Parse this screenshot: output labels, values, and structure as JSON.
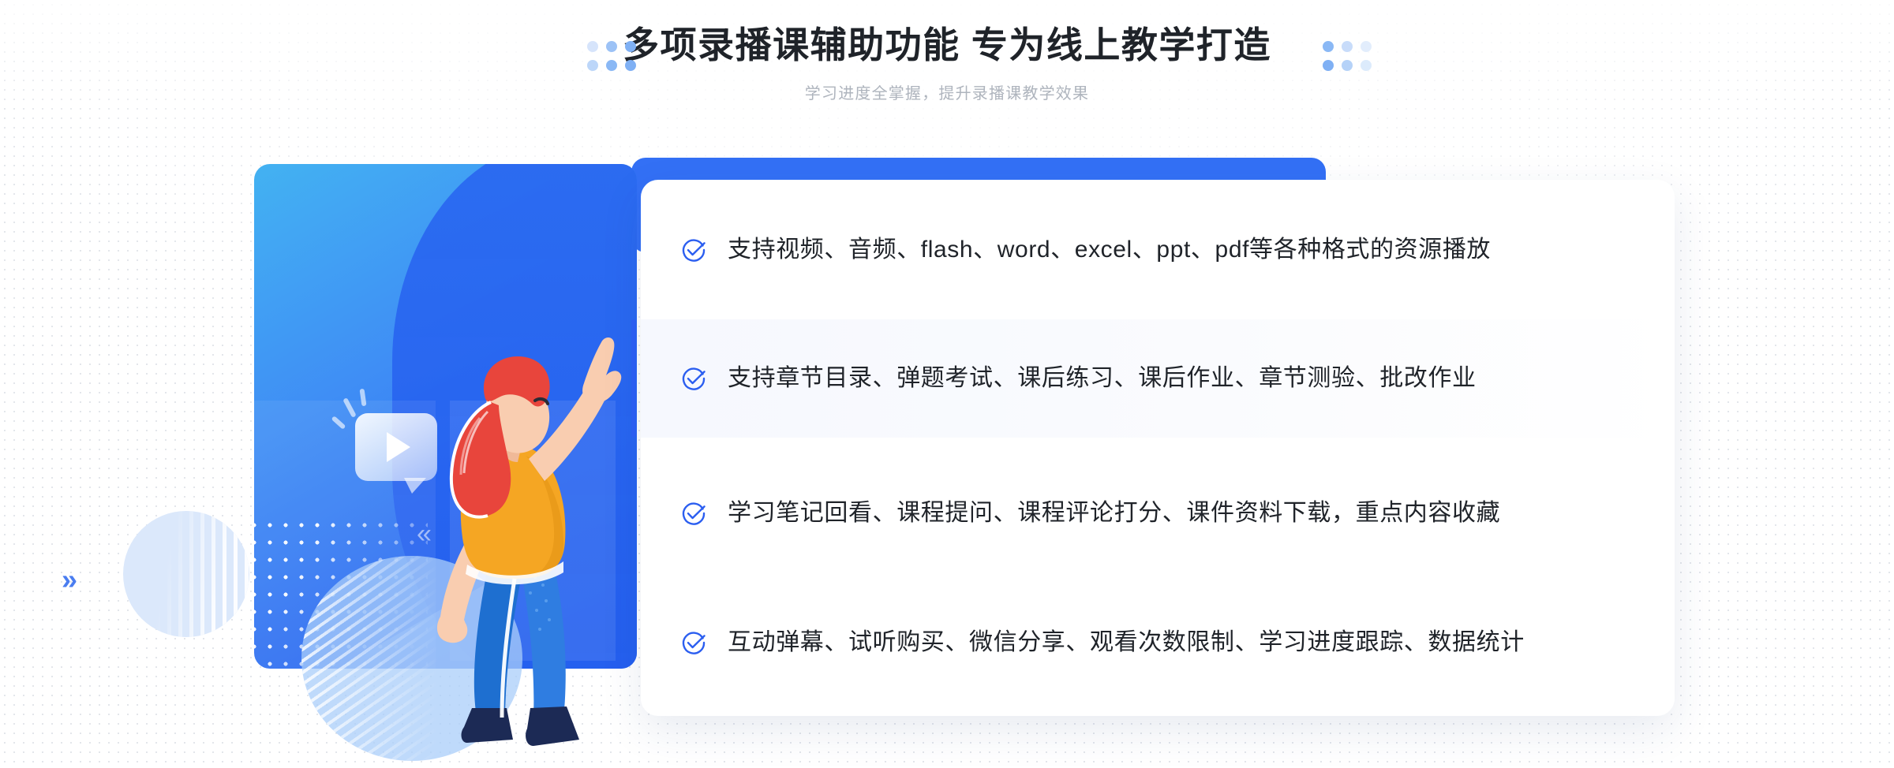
{
  "header": {
    "title": "多项录播课辅助功能 专为线上教学打造",
    "subtitle": "学习进度全掌握，提升录播课教学效果"
  },
  "colors": {
    "accent_blue": "#3370f5",
    "deep_blue": "#2560ee",
    "cyan_blue": "#43b2f2",
    "check_blue": "#2b5ef0",
    "title_text": "#1f2329",
    "subtitle_text": "#aeb4bd",
    "highlight_bg": "#f6f8fe",
    "dot_pattern": "#d9dde4",
    "shirt_yellow": "#f5a623",
    "hair_red": "#e8453c",
    "pants_blue": "#2f7de1",
    "shoe_navy": "#1c2a55",
    "skin": "#f9cdb0"
  },
  "decorations": {
    "dot_cluster_left": [
      "#d6e4fb",
      "#9cc2f6",
      "#7fb0f4",
      "#bcd6f9",
      "#8ab8f5",
      "#7fb0f4"
    ],
    "dot_cluster_right": [
      "#8ab8f5",
      "#c8dcfa",
      "#e2edfc",
      "#7fb0f4",
      "#b5d2f8",
      "#dcebfc"
    ],
    "chevron_page": "»",
    "chevron_illustration": "«"
  },
  "illustration": {
    "play_icon_label": "play-button-icon",
    "bubble_label": "video-speech-bubble"
  },
  "features": [
    {
      "id": "resource-playback",
      "text": "支持视频、音频、flash、word、excel、ppt、pdf等各种格式的资源播放",
      "highlighted": false
    },
    {
      "id": "chapters-exams",
      "text": "支持章节目录、弹题考试、课后练习、课后作业、章节测验、批改作业",
      "highlighted": true
    },
    {
      "id": "notes-comments",
      "text": "学习笔记回看、课程提问、课程评论打分、课件资料下载，重点内容收藏",
      "highlighted": false
    },
    {
      "id": "interaction-stats",
      "text": "互动弹幕、试听购买、微信分享、观看次数限制、学习进度跟踪、数据统计",
      "highlighted": false
    }
  ]
}
